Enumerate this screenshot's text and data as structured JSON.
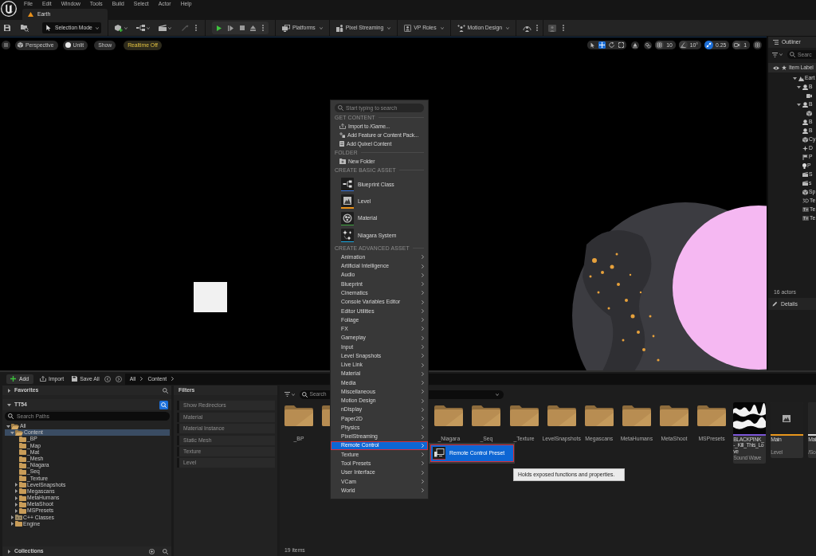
{
  "menu_bar": {
    "items": [
      "File",
      "Edit",
      "Window",
      "Tools",
      "Build",
      "Select",
      "Actor",
      "Help"
    ]
  },
  "level_tab": {
    "label": "Earth"
  },
  "toolbar": {
    "mode": "Selection Mode",
    "buttons": [
      {
        "kind": "platforms",
        "label": "Platforms"
      },
      {
        "kind": "pixel_streaming",
        "label": "Pixel Streaming"
      },
      {
        "kind": "vp_roles",
        "label": "VP Roles"
      },
      {
        "kind": "motion_design",
        "label": "Motion Design"
      }
    ]
  },
  "viewport": {
    "pills": [
      {
        "kind": "perspective",
        "label": "Perspective"
      },
      {
        "kind": "lighting",
        "label": "Unlit"
      },
      {
        "kind": "show",
        "label": "Show"
      },
      {
        "kind": "realtime",
        "label": "Realtime Off"
      }
    ],
    "transform_tools": [
      {
        "kind": "select",
        "selected": false
      },
      {
        "kind": "move",
        "selected": true
      },
      {
        "kind": "rotate",
        "selected": false
      },
      {
        "kind": "scale",
        "selected": false
      }
    ],
    "snaps": [
      {
        "kind": "grid",
        "label": "10",
        "on": false
      },
      {
        "kind": "angle",
        "label": "10°",
        "on": false
      },
      {
        "kind": "scale",
        "label": "0.25",
        "on": true
      },
      {
        "kind": "camera_speed",
        "label": "1",
        "on": false
      }
    ]
  },
  "outliner": {
    "title": "Outliner",
    "search_placeholder": "Searc",
    "column_header": "Item Label",
    "rows": [
      {
        "kind": "world",
        "label": "Eart",
        "expanded": true,
        "children": [
          {
            "kind": "blueprint",
            "label": "B",
            "expanded": true,
            "children": [
              {
                "kind": "camera"
              }
            ]
          },
          {
            "kind": "blueprint",
            "label": "B",
            "expanded": true,
            "children": [
              {
                "kind": "mesh"
              }
            ]
          },
          {
            "kind": "blueprint",
            "label": "B"
          },
          {
            "kind": "blueprint",
            "label": "B"
          },
          {
            "kind": "mesh",
            "label": "Cy"
          },
          {
            "kind": "sparkle",
            "label": "D"
          },
          {
            "kind": "flag",
            "label": "P"
          },
          {
            "kind": "bulb",
            "label": "P"
          },
          {
            "kind": "clapper",
            "label": "S"
          },
          {
            "kind": "clapper",
            "label": "s"
          },
          {
            "kind": "mesh",
            "label": "Sp"
          },
          {
            "kind": "text_3d",
            "label": "Te"
          },
          {
            "kind": "text",
            "label": "Te"
          },
          {
            "kind": "text",
            "label": "Te"
          }
        ]
      }
    ],
    "count": "16 actors",
    "details_tab": "Details"
  },
  "add_menu": {
    "search_placeholder": "Start typing to search",
    "sections": [
      {
        "kind": "actions",
        "title": "GET CONTENT",
        "items": [
          {
            "kind": "import",
            "label": "Import to /Game..."
          },
          {
            "kind": "feature_pack",
            "label": "Add Feature or Content Pack..."
          },
          {
            "kind": "quixel",
            "label": "Add Quixel Content"
          }
        ]
      },
      {
        "kind": "actions",
        "title": "FOLDER",
        "items": [
          {
            "kind": "new_folder",
            "label": "New Folder"
          }
        ]
      },
      {
        "kind": "basic",
        "title": "CREATE BASIC ASSET",
        "items": [
          {
            "kind": "blueprint",
            "label": "Blueprint Class",
            "color": "#3b78e0"
          },
          {
            "kind": "level",
            "label": "Level",
            "color": "#e8901a"
          },
          {
            "kind": "material",
            "label": "Material",
            "color": "#3fa33f"
          },
          {
            "kind": "niagara",
            "label": "Niagara System",
            "color": "#1aa8e0"
          }
        ]
      },
      {
        "kind": "advanced",
        "title": "CREATE ADVANCED ASSET",
        "items": [
          {
            "label": "Animation",
            "selected": false
          },
          {
            "label": "Artificial Intelligence",
            "selected": false
          },
          {
            "label": "Audio",
            "selected": false
          },
          {
            "label": "Blueprint",
            "selected": false
          },
          {
            "label": "Cinematics",
            "selected": false
          },
          {
            "label": "Console Variables Editor",
            "selected": false
          },
          {
            "label": "Editor Utilities",
            "selected": false
          },
          {
            "label": "Foliage",
            "selected": false
          },
          {
            "label": "FX",
            "selected": false
          },
          {
            "label": "Gameplay",
            "selected": false
          },
          {
            "label": "Input",
            "selected": false
          },
          {
            "label": "Level Snapshots",
            "selected": false
          },
          {
            "label": "Live Link",
            "selected": false
          },
          {
            "label": "Material",
            "selected": false
          },
          {
            "label": "Media",
            "selected": false
          },
          {
            "label": "Miscellaneous",
            "selected": false
          },
          {
            "label": "Motion Design",
            "selected": false
          },
          {
            "label": "nDisplay",
            "selected": false
          },
          {
            "label": "Paper2D",
            "selected": false
          },
          {
            "label": "Physics",
            "selected": false
          },
          {
            "label": "PixelStreaming",
            "selected": false
          },
          {
            "label": "Remote Control",
            "selected": true
          },
          {
            "label": "Texture",
            "selected": false
          },
          {
            "label": "Tool Presets",
            "selected": false
          },
          {
            "label": "User Interface",
            "selected": false
          },
          {
            "label": "VCam",
            "selected": false
          },
          {
            "label": "World",
            "selected": false
          }
        ]
      }
    ]
  },
  "submenu": {
    "label": "Remote Control Preset",
    "selected": true,
    "color": "#c8282a"
  },
  "tooltip": {
    "text": "Holds exposed functions and properties."
  },
  "content_browser": {
    "toolbar": {
      "add": "Add",
      "import": "Import",
      "save_all": "Save All",
      "path": [
        "All",
        "Content"
      ]
    },
    "sources": {
      "favorites": {
        "label": "Favorites",
        "expanded": false
      },
      "project": {
        "label": "TT54",
        "expanded": true
      },
      "search_placeholder": "Search Paths",
      "tree": [
        {
          "kind": "folder",
          "label": "All",
          "expandable": true,
          "expanded": true,
          "selected": false,
          "children": [
            {
              "kind": "folder",
              "label": "Content",
              "expandable": true,
              "expanded": true,
              "selected": true,
              "children": [
                {
                  "kind": "folder",
                  "label": "_BP",
                  "expandable": false,
                  "expanded": false,
                  "selected": false
                },
                {
                  "kind": "folder",
                  "label": "_Map",
                  "expandable": false,
                  "expanded": false,
                  "selected": false
                },
                {
                  "kind": "folder",
                  "label": "_Mat",
                  "expandable": false,
                  "expanded": false,
                  "selected": false
                },
                {
                  "kind": "folder",
                  "label": "_Mesh",
                  "expandable": false,
                  "expanded": false,
                  "selected": false
                },
                {
                  "kind": "folder",
                  "label": "_Niagara",
                  "expandable": false,
                  "expanded": false,
                  "selected": false
                },
                {
                  "kind": "folder",
                  "label": "_Seq",
                  "expandable": false,
                  "expanded": false,
                  "selected": false
                },
                {
                  "kind": "folder",
                  "label": "_Texture",
                  "expandable": false,
                  "expanded": false,
                  "selected": false
                },
                {
                  "kind": "folder",
                  "label": "LevelSnapshots",
                  "expandable": true,
                  "expanded": false,
                  "selected": false
                },
                {
                  "kind": "folder",
                  "label": "Megascans",
                  "expandable": true,
                  "expanded": false,
                  "selected": false
                },
                {
                  "kind": "folder",
                  "label": "MetaHumans",
                  "expandable": true,
                  "expanded": false,
                  "selected": false
                },
                {
                  "kind": "folder",
                  "label": "MetaShoot",
                  "expandable": true,
                  "expanded": false,
                  "selected": false
                },
                {
                  "kind": "folder",
                  "label": "MSPresets",
                  "expandable": true,
                  "expanded": false,
                  "selected": false
                }
              ]
            },
            {
              "kind": "code_folder",
              "label": "C++ Classes",
              "expandable": true,
              "expanded": false,
              "selected": false
            },
            {
              "kind": "folder",
              "label": "Engine",
              "expandable": true,
              "expanded": false,
              "selected": false
            }
          ]
        }
      ],
      "collections": {
        "label": "Collections",
        "expanded": false
      }
    },
    "filters": {
      "title": "Filters",
      "items": [
        {
          "label": "Show Redirectors",
          "checked": false
        },
        {
          "label": "Material",
          "checked": false
        },
        {
          "label": "Material Instance",
          "checked": false
        },
        {
          "label": "Static Mesh",
          "checked": false
        },
        {
          "label": "Texture",
          "checked": false
        },
        {
          "label": "Level",
          "checked": false
        }
      ]
    },
    "assets": {
      "search_placeholder": "Search",
      "items": [
        {
          "kind": "folder",
          "name": "_BP"
        },
        {
          "kind": "folder"
        },
        {
          "kind": "folder",
          "name": "_Niagara"
        },
        {
          "kind": "folder",
          "name": "_Seq"
        },
        {
          "kind": "folder",
          "name": "_Texture"
        },
        {
          "kind": "folder",
          "name": "LevelSnapshots"
        },
        {
          "kind": "folder",
          "name": "Megascans"
        },
        {
          "kind": "folder",
          "name": "MetaHumans"
        },
        {
          "kind": "folder",
          "name": "MetaShoot"
        },
        {
          "kind": "folder",
          "name": "MSPresets"
        },
        {
          "kind": "sound_wave",
          "name": "BLACKPINK_-_Kill_This_Love",
          "type": "Sound Wave",
          "color": "#7b55d6"
        },
        {
          "kind": "level",
          "name": "Main",
          "type": "Level",
          "color": "#e8961c"
        },
        {
          "kind": "blank",
          "name": "Mai",
          "type": "/So",
          "color": "#d8d8d8"
        }
      ],
      "count": "19 items"
    }
  }
}
